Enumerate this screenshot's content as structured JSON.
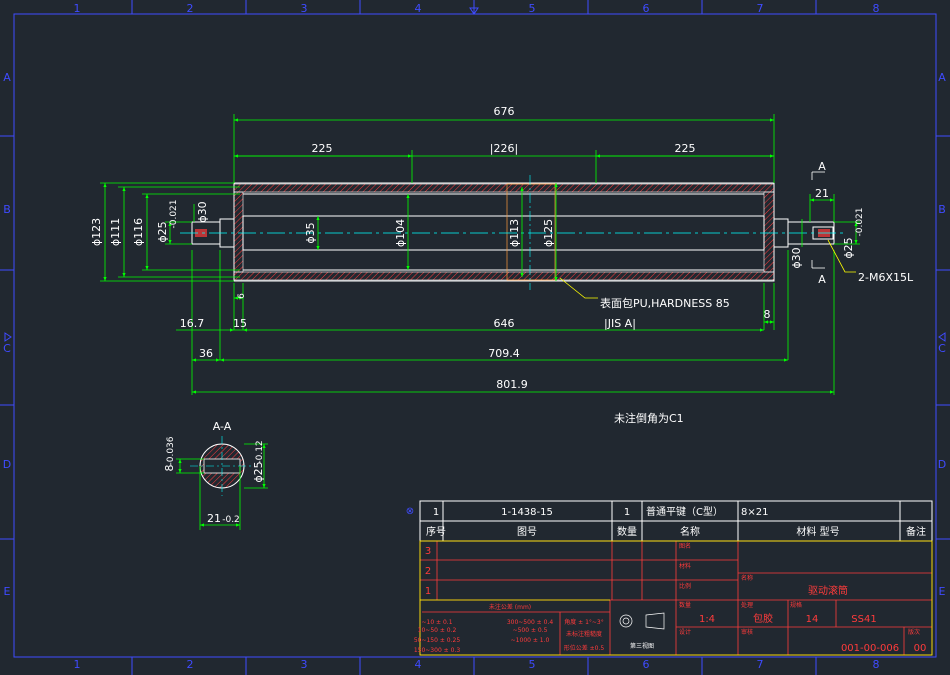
{
  "border": {
    "col_labels": [
      "1",
      "2",
      "3",
      "4",
      "5",
      "6",
      "7",
      "8"
    ],
    "row_labels": [
      "A",
      "B",
      "C",
      "D",
      "E"
    ]
  },
  "dimensions": {
    "overall_676": "676",
    "left_225": "225",
    "mid_226": "|226|",
    "right_225": "225",
    "right_21": "21",
    "dia_123": "ϕ123",
    "dia_111": "ϕ111",
    "dia_116": "ϕ116",
    "dia_25_left": "ϕ25",
    "dia_25_left_tol": "-0.021",
    "dia_30_left": "ϕ30",
    "dia_35": "ϕ35",
    "dia_104": "ϕ104",
    "dia_113": "ϕ113",
    "dia_125": "ϕ125",
    "dia_30_right": "ϕ30",
    "dia_25_right": "ϕ25",
    "dia_25_right_tol": "-0.021",
    "d_16_7": "16.7",
    "d_15": "15",
    "d_646": "646",
    "d_8": "8",
    "d_36": "36",
    "d_709_4": "709.4",
    "d_801_9": "801.9",
    "d_6": "6",
    "thread": "2-M6X15L",
    "section_mark": "A"
  },
  "notes": {
    "coating_line1": "表面包PU,HARDNESS 85",
    "coating_line2": "|JIS A|",
    "chamfer": "未注倒角为C1"
  },
  "section_view": {
    "title": "A-A",
    "key_width": "8",
    "key_width_tol": "-0.036",
    "dia": "ϕ25",
    "dia_tol": "-0.12",
    "depth": "21",
    "depth_tol": "-0.2"
  },
  "parts_list": {
    "row": [
      "1",
      "1-1438-15",
      "1",
      "普通平键（C型）",
      "8×21",
      ""
    ],
    "headers": [
      "序号",
      "图号",
      "数量",
      "名称",
      "材料 型号",
      "备注"
    ],
    "empty_rows": [
      "3",
      "2",
      "1"
    ]
  },
  "title_block": {
    "tolerance_title": "未注公差 (mm)",
    "tol_left": [
      "~10 ± 0.1",
      "10~50 ± 0.2",
      "50~150 ± 0.25",
      "150~300 ± 0.3"
    ],
    "tol_mid": [
      "300~500 ± 0.4",
      "~500 ± 0.5",
      "~1000 ± 1.0"
    ],
    "tol_right": [
      "角度 ± 1°~3°",
      "未标注粗糙度",
      "形位公差 ±0.5"
    ],
    "projection_label": "第三视图",
    "scale": "1:4",
    "material": "包胶",
    "quantity": "14",
    "standard": "SS41",
    "name": "驱动滚筒",
    "drawing_no": "001-00-006",
    "rev": "00",
    "small_labels": [
      "图名",
      "材料",
      "比例",
      "数量",
      "处理",
      "名称",
      "设计",
      "审核",
      "规格",
      "版次"
    ]
  },
  "colors": {
    "background": "#212830",
    "border": "#3f4bff",
    "dimension": "#00ff00",
    "outline": "#ffffff",
    "hatch": "#ff3b3b",
    "centerline": "#00ffff",
    "leader": "#ffff00",
    "frame_yellow": "#ffff00"
  }
}
